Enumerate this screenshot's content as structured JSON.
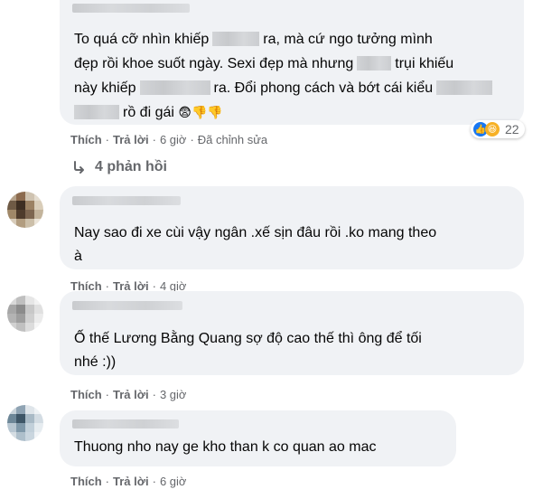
{
  "comments": [
    {
      "text_lines": [
        "To quá cỡ nhìn khiếp",
        "ra, mà cứ ngo tưởng mình",
        "đẹp rồi khoe suốt ngày. Sexi đẹp mà nhưng",
        "trụi khiếu",
        "này khiếp",
        "ra. Đổi phong cách và bớt cái kiểu",
        "rồ đi gái"
      ],
      "emoji": "😨👎👎",
      "reaction_count": "22",
      "actions": {
        "like": "Thích",
        "reply": "Trả lời",
        "time": "6 giờ",
        "edited": "Đã chỉnh sửa"
      },
      "replies_label": "4 phản hồi"
    },
    {
      "text_lines": [
        "Nay sao đi xe cùi vậy ngân .xế sịn đâu rồi .ko mang theo",
        "à"
      ],
      "actions": {
        "like": "Thích",
        "reply": "Trả lời",
        "time": "4 giờ"
      }
    },
    {
      "text_lines": [
        "Ố thế Lương Bằng Quang sợ độ cao thế thì ông để tối",
        "nhé :))"
      ],
      "actions": {
        "like": "Thích",
        "reply": "Trả lời",
        "time": "3 giờ"
      }
    },
    {
      "text_lines": [
        "Thuong nho nay ge kho than k co quan ao mac"
      ],
      "actions": {
        "like": "Thích",
        "reply": "Trả lời",
        "time": "6 giờ"
      }
    }
  ],
  "colors": {
    "bubble": "#f0f2f5",
    "meta": "#65676b",
    "like": "#1877f2",
    "haha": "#f7b125"
  },
  "icons": {
    "reply_arrow": "reply-arrow-icon",
    "like": "like-reaction-icon",
    "haha": "haha-reaction-icon"
  }
}
